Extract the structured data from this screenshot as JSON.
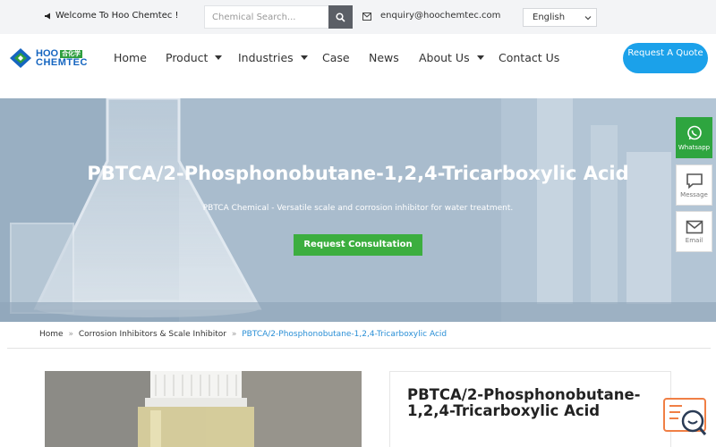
{
  "topbar": {
    "welcome": "Welcome To Hoo Chemtec !",
    "search_placeholder": "Chemical Search...",
    "email": "enquiry@hoochemtec.com",
    "language": "English"
  },
  "logo": {
    "top": "HOO",
    "cn": "合化学",
    "bottom": "CHEMTEC"
  },
  "nav": {
    "items": [
      {
        "label": "Home"
      },
      {
        "label": "Product"
      },
      {
        "label": "Industries"
      },
      {
        "label": "Case"
      },
      {
        "label": "News"
      },
      {
        "label": "About Us"
      },
      {
        "label": "Contact Us"
      }
    ],
    "quote_button": "Request A Quote"
  },
  "hero": {
    "title": "PBTCA/2-Phosphonobutane-1,2,4-Tricarboxylic Acid",
    "subtitle": "PBTCA Chemical - Versatile scale and corrosion inhibitor for water treatment.",
    "button": "Request Consultation"
  },
  "side_buttons": [
    {
      "label": "Whatsapp",
      "icon": "whatsapp-icon"
    },
    {
      "label": "Message",
      "icon": "message-icon"
    },
    {
      "label": "Email",
      "icon": "email-icon"
    }
  ],
  "breadcrumb": {
    "home": "Home",
    "category": "Corrosion Inhibitors & Scale Inhibitor",
    "separator": "»",
    "current": "PBTCA/2-Phosphonobutane-1,2,4-Tricarboxylic Acid"
  },
  "product": {
    "title": "PBTCA/2-Phosphonobutane-1,2,4-Tricarboxylic Acid"
  },
  "colors": {
    "accent_blue": "#1ba1ea",
    "green": "#3cae3f",
    "link_blue": "#2a8fd6"
  }
}
